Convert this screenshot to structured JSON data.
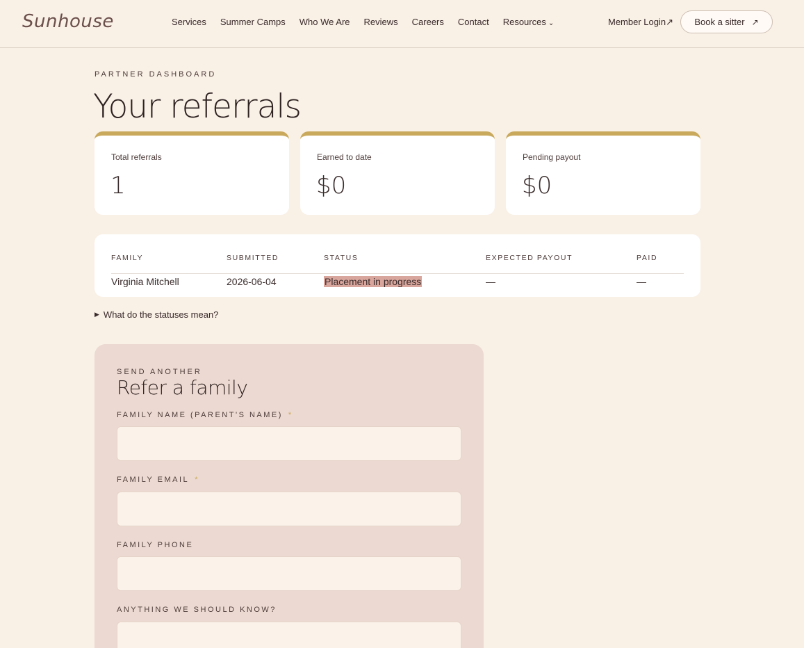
{
  "header": {
    "logo": "Sunhouse",
    "nav": [
      "Services",
      "Summer Camps",
      "Who We Are",
      "Reviews",
      "Careers",
      "Contact",
      "Resources"
    ],
    "resources_chevron": "⌄",
    "member_login": "Member Login↗",
    "book_label": "Book a sitter",
    "book_arrow": "↗"
  },
  "page": {
    "eyebrow": "PARTNER DASHBOARD",
    "title": "Your referrals"
  },
  "stats": [
    {
      "label": "Total referrals",
      "value": "1"
    },
    {
      "label": "Earned to date",
      "value": "$0"
    },
    {
      "label": "Pending payout",
      "value": "$0"
    }
  ],
  "table": {
    "headers": [
      "FAMILY",
      "SUBMITTED",
      "STATUS",
      "EXPECTED PAYOUT",
      "PAID"
    ],
    "rows": [
      {
        "family": "Virginia Mitchell",
        "submitted": "2026-06-04",
        "status": "Placement in progress",
        "expected": "—",
        "paid": "—"
      }
    ]
  },
  "details_summary": "What do the statuses mean?",
  "form": {
    "eyebrow": "SEND ANOTHER",
    "title": "Refer a family",
    "fields": [
      {
        "label": "FAMILY NAME (PARENT'S NAME)",
        "required": "*"
      },
      {
        "label": "FAMILY EMAIL",
        "required": "*"
      },
      {
        "label": "FAMILY PHONE",
        "required": ""
      },
      {
        "label": "ANYTHING WE SHOULD KNOW?",
        "required": ""
      }
    ]
  },
  "colors": {
    "background": "#f9f0e6",
    "accent_gold": "#c9a95c",
    "form_card": "#ecd9d1",
    "status_highlight": "#d8a69c"
  }
}
